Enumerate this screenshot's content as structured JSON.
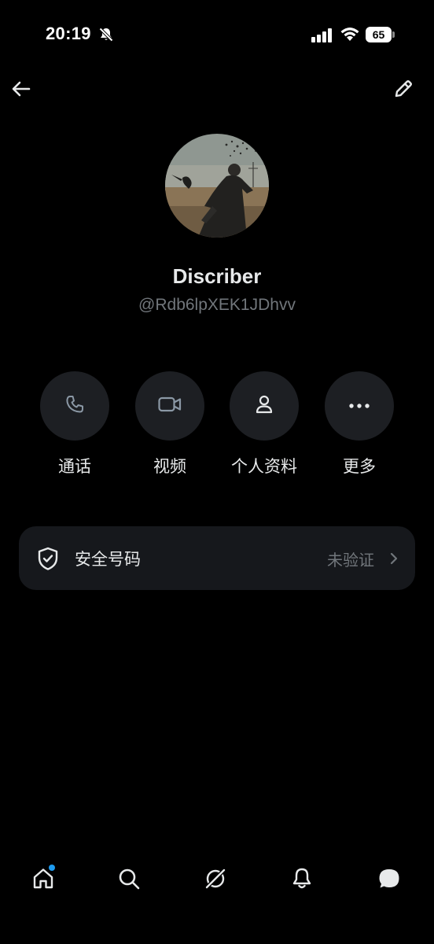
{
  "status_bar": {
    "time": "20:19",
    "battery": "65",
    "icons": [
      "bell-slash-icon",
      "cellular-signal-icon",
      "wifi-icon",
      "battery-icon"
    ]
  },
  "top_nav": {
    "icons": [
      "arrow-left-icon",
      "pencil-icon"
    ]
  },
  "profile": {
    "display_name": "Discriber",
    "handle": "@Rdb6lpXEK1JDhvv"
  },
  "actions": [
    {
      "label": "通话",
      "icon": "phone-icon"
    },
    {
      "label": "视频",
      "icon": "video-camera-icon"
    },
    {
      "label": "个人资料",
      "icon": "person-icon"
    },
    {
      "label": "更多",
      "icon": "more-dots-icon"
    }
  ],
  "security": {
    "label": "安全号码",
    "status": "未验证",
    "icon": "shield-check-icon"
  },
  "bottom_nav": {
    "items": [
      "home-icon",
      "search-icon",
      "grok-icon",
      "bell-icon",
      "messages-icon"
    ],
    "badge_color": "#1d9bf0"
  },
  "colors": {
    "background": "#000000",
    "primary_text": "#e7e9ea",
    "secondary_text": "#71767b",
    "button_bg": "#1d1f23",
    "card_bg": "#16181c",
    "accent": "#1d9bf0"
  }
}
